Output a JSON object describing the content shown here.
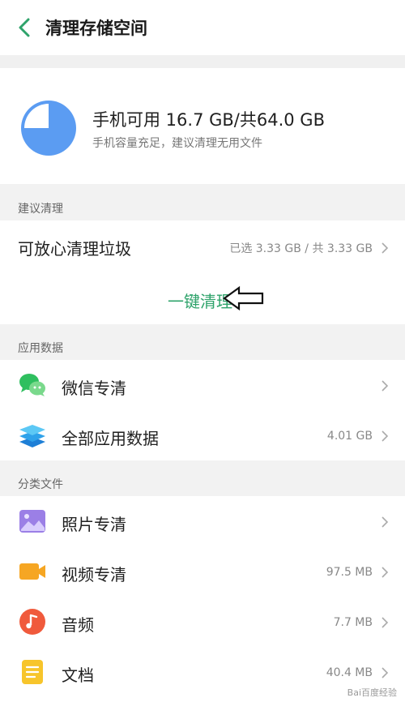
{
  "header": {
    "title": "清理存储空间"
  },
  "summary": {
    "main_text": "手机可用 16.7 GB/共64.0 GB",
    "sub_text": "手机容量充足，建议清理无用文件"
  },
  "sections": {
    "suggested": "建议清理",
    "app_data": "应用数据",
    "category": "分类文件"
  },
  "suggested_row": {
    "title": "可放心清理垃圾",
    "value": "已选 3.33 GB / 共 3.33 GB"
  },
  "clean_button": {
    "label": "一键清理"
  },
  "app_rows": [
    {
      "title": "微信专清",
      "value": ""
    },
    {
      "title": "全部应用数据",
      "value": "4.01 GB"
    }
  ],
  "category_rows": [
    {
      "title": "照片专清",
      "value": ""
    },
    {
      "title": "视频专清",
      "value": "97.5 MB"
    },
    {
      "title": "音频",
      "value": "7.7 MB"
    },
    {
      "title": "文档",
      "value": "40.4 MB"
    }
  ],
  "watermark": "Bai百度经验",
  "colors": {
    "accent": "#2fa36b",
    "pie_blue": "#5b9cf2"
  },
  "icons": [
    "back-arrow-icon",
    "storage-pie-icon",
    "wechat-icon",
    "app-data-icon",
    "photo-icon",
    "video-icon",
    "audio-icon",
    "document-icon",
    "chevron-right-icon",
    "pointer-arrow-icon"
  ]
}
